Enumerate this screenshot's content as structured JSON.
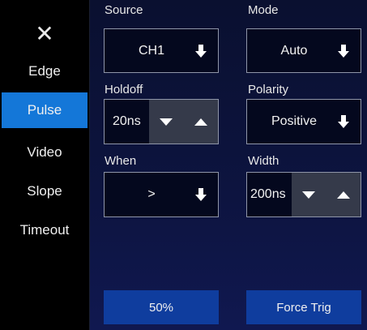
{
  "sidebar": {
    "close_icon": "close-icon",
    "items": [
      {
        "label": "Edge",
        "active": false
      },
      {
        "label": "Pulse",
        "active": true
      },
      {
        "label": "Video",
        "active": false
      },
      {
        "label": "Slope",
        "active": false
      },
      {
        "label": "Timeout",
        "active": false
      }
    ]
  },
  "fields": {
    "source": {
      "label": "Source",
      "value": "CH1"
    },
    "mode": {
      "label": "Mode",
      "value": "Auto"
    },
    "holdoff": {
      "label": "Holdoff",
      "value": "20ns"
    },
    "polarity": {
      "label": "Polarity",
      "value": "Positive"
    },
    "when": {
      "label": "When",
      "value": ">"
    },
    "width": {
      "label": "Width",
      "value": "200ns"
    }
  },
  "buttons": {
    "fifty_percent": "50%",
    "force_trig": "Force Trig"
  },
  "colors": {
    "active_tab": "#1477d8",
    "panel_bg": "#0d1440",
    "button_bg": "#0f3d9e"
  }
}
